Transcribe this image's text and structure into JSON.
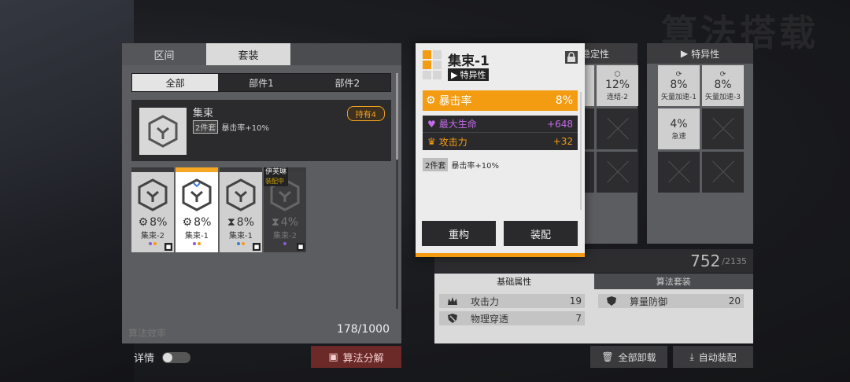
{
  "background": {
    "title": "算法搭载"
  },
  "left": {
    "tabs": [
      "区间",
      "套装"
    ],
    "filters": [
      "全部",
      "部件1",
      "部件2"
    ],
    "set_card": {
      "name": "集束",
      "pieces_tag": "2件套",
      "bonus": "暴击率+10%",
      "owned_badge": "持有4"
    },
    "items": [
      {
        "pct": "8%",
        "name": "集束-2",
        "stat_icon": "gear-icon",
        "locked": true
      },
      {
        "pct": "8%",
        "name": "集束-1",
        "stat_icon": "gear-icon",
        "selected": true
      },
      {
        "pct": "8%",
        "name": "集束-1",
        "stat_icon": "hourglass-icon",
        "locked": true
      },
      {
        "pct": "4%",
        "name": "集束-2",
        "stat_icon": "hourglass-icon",
        "owner": "伊芙琳",
        "owner_status": "装配中",
        "locked": true
      }
    ],
    "count": "178/1000",
    "efficiency_label": "算法效率"
  },
  "detail_label": "详情",
  "decompose_label": "算法分解",
  "right": {
    "stable_header": "稳定性",
    "special_header": "特异性",
    "stable_slots": [
      {
        "pct": "12%",
        "name": "连结-2"
      }
    ],
    "special_slots": [
      {
        "pct": "8%",
        "name": "矢量加速-1"
      },
      {
        "pct": "8%",
        "name": "矢量加速-3"
      },
      {
        "pct": "4%",
        "name": "急速"
      }
    ],
    "efficiency_value": "752",
    "efficiency_max": "/2135",
    "stat_tabs": [
      "基础属性",
      "算法套装"
    ],
    "stats": [
      {
        "label": "攻击力",
        "value": "19"
      },
      {
        "label": "算量防御",
        "value": "20"
      },
      {
        "label": "物理穿透",
        "value": "7"
      }
    ],
    "unequip_all": "全部卸载",
    "auto_equip": "自动装配"
  },
  "popup": {
    "name": "集束-1",
    "type": "特异性",
    "main_stat": {
      "label": "暴击率",
      "value": "8%"
    },
    "sub_stats": [
      {
        "label": "最大生命",
        "value": "+648",
        "color": "#c36ae8"
      },
      {
        "label": "攻击力",
        "value": "+32",
        "color": "#f39c12"
      }
    ],
    "set_tag": "2件套",
    "set_bonus": "暴击率+10%",
    "rebuild_label": "重构",
    "equip_label": "装配"
  },
  "colors": {
    "accent": "#f39c12",
    "purple": "#c36ae8"
  }
}
